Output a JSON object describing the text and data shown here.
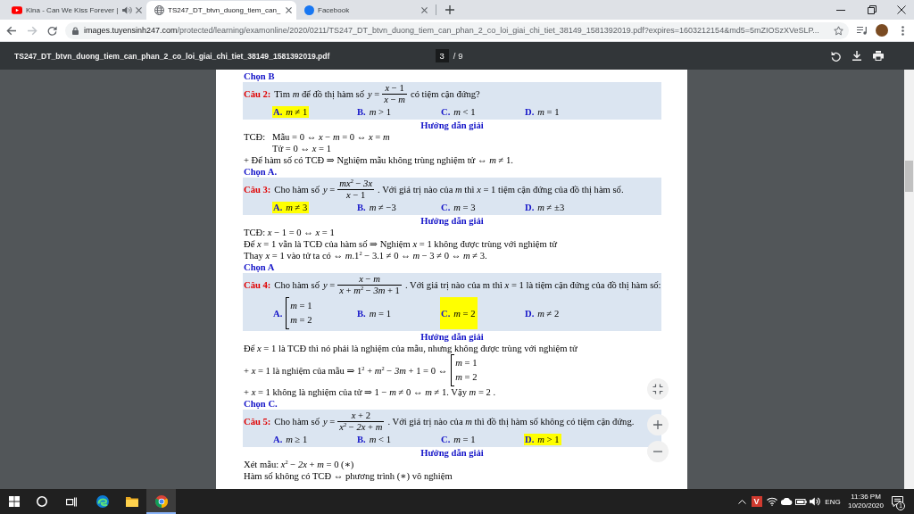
{
  "browser": {
    "tabs": [
      {
        "kind": "video",
        "title": "Kina - Can We Kiss Forever |",
        "audio": true,
        "selected": false
      },
      {
        "kind": "document",
        "title": "TS247_DT_btvn_duong_tiem_can_",
        "audio": false,
        "selected": true
      },
      {
        "kind": "social",
        "title": "Facebook",
        "audio": false,
        "selected": false
      }
    ],
    "back_disabled": false,
    "forward_disabled": true,
    "address": {
      "host": "images.tuyensinh247.com",
      "path": "/protected/learning/examonline/2020/0211/TS247_DT_btvn_duong_tiem_can_phan_2_co_loi_giai_chi_tiet_38149_1581392019.pdf?expires=1603212154&md5=5mZIOSzXVeSLP..."
    }
  },
  "pdf_toolbar": {
    "title": "TS247_DT_btvn_duong_tiem_can_phan_2_co_loi_giai_chi_tiet_38149_1581392019.pdf",
    "page": "3",
    "page_count": "/ 9"
  },
  "page": {
    "blocks": [
      {
        "kind": "answer",
        "text": "Chọn B"
      },
      {
        "kind": "question",
        "number": "Câu 2:",
        "stem": [
          {
            "kind": "text",
            "text": "Tìm *m* để đồ thị hàm số"
          },
          {
            "kind": "fraction",
            "lhs": "*y* =",
            "numerator": "*x* − 1",
            "denominator": "*x* − *m*"
          },
          {
            "kind": "text",
            "text": "có tiệm cận đứng?"
          }
        ],
        "options": [
          {
            "letter": "A.",
            "kind": "text",
            "value": "*m* ≠ 1",
            "highlighted": true
          },
          {
            "letter": "B.",
            "kind": "text",
            "value": "*m* > 1",
            "highlighted": false
          },
          {
            "letter": "C.",
            "kind": "text",
            "value": "*m* < 1",
            "highlighted": false
          },
          {
            "letter": "D.",
            "kind": "text",
            "value": "*m* = 1",
            "highlighted": false
          }
        ]
      },
      {
        "kind": "heading",
        "text": "Hướng dẫn giải"
      },
      {
        "kind": "aligned",
        "label": "TCĐ:",
        "lines": [
          "Mẫu = 0 ⇔ *x* − *m* = 0 ⇔ *x* = *m*",
          "Tử = 0 ⇔ *x* = 1"
        ]
      },
      {
        "kind": "line",
        "text": "+ Để hàm số có TCĐ ⇒ Nghiệm mẫu không trùng nghiệm tử ⇔ *m* ≠ 1."
      },
      {
        "kind": "answer",
        "text": "Chọn A."
      },
      {
        "kind": "question",
        "number": "Câu 3:",
        "stem": [
          {
            "kind": "text",
            "text": "Cho hàm số"
          },
          {
            "kind": "fraction",
            "lhs": "*y* =",
            "numerator": "*mx*$^{2}$ − *3x*",
            "denominator": "*x* − 1"
          },
          {
            "kind": "text",
            "text": ". Với giá trị nào của *m* thì *x* = 1 tiệm cận đứng của đồ thị hàm số."
          }
        ],
        "options": [
          {
            "letter": "A.",
            "kind": "text",
            "value": "*m* ≠ 3",
            "highlighted": true
          },
          {
            "letter": "B.",
            "kind": "text",
            "value": "*m* ≠ −3",
            "highlighted": false
          },
          {
            "letter": "C.",
            "kind": "text",
            "value": "*m* = 3",
            "highlighted": false
          },
          {
            "letter": "D.",
            "kind": "text",
            "value": "*m* ≠ ±3",
            "highlighted": false
          }
        ]
      },
      {
        "kind": "heading",
        "text": "Hướng dẫn giải"
      },
      {
        "kind": "line",
        "text": "TCĐ: *x* − 1 = 0 ⇔ *x* = 1"
      },
      {
        "kind": "line",
        "text": "Để *x* = 1 vẫn là TCĐ của hàm số ⇒ Nghiệm *x* = 1 không được trùng với nghiệm tử"
      },
      {
        "kind": "line",
        "text": "Thay *x* = 1 vào tử ta có ⇔ *m*.1$^{2}$ − 3.1 ≠ 0 ⇔ *m* − 3 ≠ 0 ⇔ *m* ≠ 3."
      },
      {
        "kind": "answer",
        "text": "Chọn A"
      },
      {
        "kind": "question",
        "number": "Câu 4:",
        "stem": [
          {
            "kind": "text",
            "text": "Cho hàm số"
          },
          {
            "kind": "fraction",
            "lhs": "*y* =",
            "numerator": "*x* − *m*",
            "denominator": "*x* + *m*$^{2}$ − *3m* + 1"
          },
          {
            "kind": "text",
            "text": ". Với giá trị nào của m thì *x* = 1 là tiệm cận đứng của đồ thị hàm số:"
          }
        ],
        "options": [
          {
            "letter": "A.",
            "kind": "cases",
            "lines": [
              "*m* = 1",
              "*m* = 2"
            ],
            "highlighted": false
          },
          {
            "letter": "B.",
            "kind": "text",
            "value": "*m* = 1",
            "highlighted": false
          },
          {
            "letter": "C.",
            "kind": "text",
            "value": "*m* = 2",
            "highlighted": true
          },
          {
            "letter": "D.",
            "kind": "text",
            "value": "*m* ≠ 2",
            "highlighted": false
          }
        ]
      },
      {
        "kind": "heading",
        "text": "Hướng dẫn giải"
      },
      {
        "kind": "line",
        "text": "Để *x* = 1 là TCĐ thì nó phải là nghiệm của mẫu, nhưng không được trùng với nghiệm tử"
      },
      {
        "kind": "line",
        "segments": [
          {
            "kind": "text",
            "text": "+ *x* = 1 là nghiệm của mẫu ⇒ 1$^{2}$ + *m*$^{2}$ − *3m* + 1 = 0 ⇔"
          },
          {
            "kind": "cases",
            "lines": [
              "*m* = 1",
              "*m* = 2"
            ]
          }
        ]
      },
      {
        "kind": "line",
        "text": "+ *x* = 1 không là nghiệm của tử ⇒ 1 − *m* ≠ 0 ⇔ *m* ≠ 1. Vậy *m* = 2 ."
      },
      {
        "kind": "answer",
        "text": "Chọn C."
      },
      {
        "kind": "question",
        "number": "Câu 5:",
        "stem": [
          {
            "kind": "text",
            "text": "Cho hàm số"
          },
          {
            "kind": "fraction",
            "lhs": "*y* =",
            "numerator": "*x* + 2",
            "denominator": "*x*$^{2}$ − *2x* + *m*"
          },
          {
            "kind": "text",
            "text": ". Với giá trị nào của *m* thì đồ thị hàm số không có tiệm cận đứng."
          }
        ],
        "options": [
          {
            "letter": "A.",
            "kind": "text",
            "value": "*m* ≥ 1",
            "highlighted": false
          },
          {
            "letter": "B.",
            "kind": "text",
            "value": "*m* < 1",
            "highlighted": false
          },
          {
            "letter": "C.",
            "kind": "text",
            "value": "*m* = 1",
            "highlighted": false
          },
          {
            "letter": "D.",
            "kind": "text",
            "value": "*m* > 1",
            "highlighted": true
          }
        ]
      },
      {
        "kind": "heading",
        "text": "Hướng dẫn giải"
      },
      {
        "kind": "line",
        "text": "Xét mẫu: *x*$^{2}$ − *2x* + *m* = 0 (∗)"
      },
      {
        "kind": "line",
        "text": "Hàm số không có TCĐ ⇔ phương trình (∗) vô nghiệm"
      }
    ]
  },
  "taskbar": {
    "pinned_apps": [
      {
        "active": false
      },
      {
        "active": false
      },
      {
        "active": true
      }
    ],
    "tray_app": "V",
    "language": "ENG",
    "time": "11:36 PM",
    "date": "10/20/2020",
    "notifications": "1"
  }
}
